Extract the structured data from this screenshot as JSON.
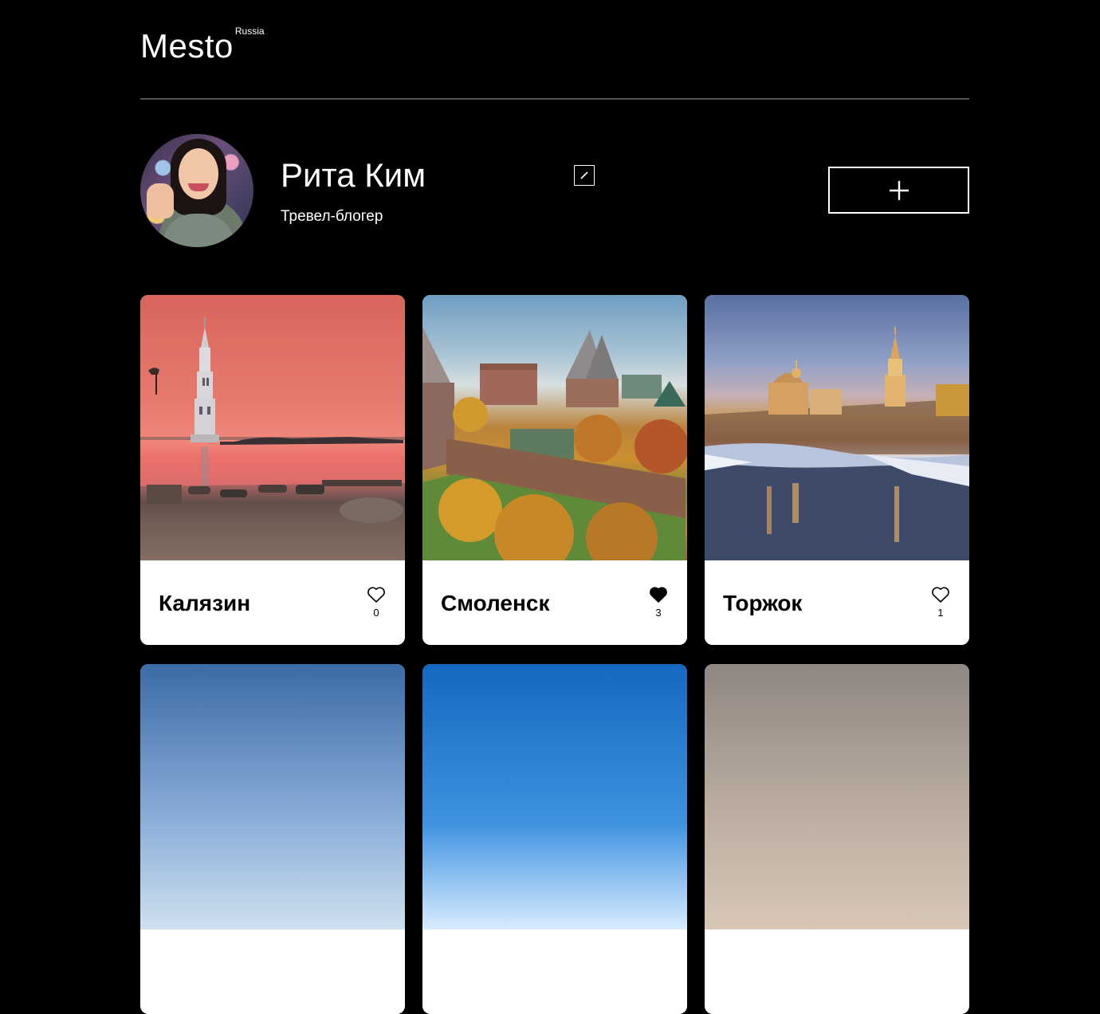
{
  "header": {
    "logo": "Mesto",
    "logo_sub": "Russia"
  },
  "profile": {
    "name": "Рита Ким",
    "about": "Тревел-блогер",
    "edit_icon": "pencil-icon",
    "add_icon": "plus-icon"
  },
  "cards": [
    {
      "title": "Калязин",
      "likes": "0",
      "liked": false
    },
    {
      "title": "Смоленск",
      "likes": "3",
      "liked": true
    },
    {
      "title": "Торжок",
      "likes": "1",
      "liked": false
    }
  ],
  "colors": {
    "background": "#000000",
    "card": "#ffffff",
    "divider": "#545454"
  }
}
